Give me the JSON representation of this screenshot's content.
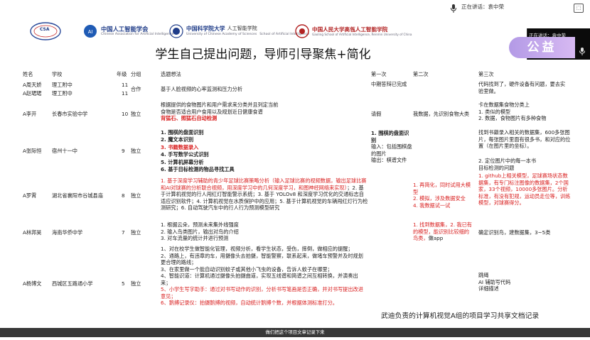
{
  "meeting": {
    "speaking_label": "正在讲话：袁中荣",
    "screen_toggle": "⬚"
  },
  "speaker": {
    "caption": "正在讲话：袁中荣"
  },
  "logos": {
    "csa": "CSA",
    "caai_cn": "中国人工智能学会",
    "caai_en": "Chinese Association for Artificial Intelligence",
    "ucas_cn": "中国科学院大学",
    "ucas_school": "人工智能学院",
    "ucas_en": "University of Chinese Academy of Sciences",
    "ucas_school_en": "School of Artificial Intelligence",
    "ruc_cn": "中国人民大学高瓴人工智能学院",
    "ruc_en": "Gaoling School of Artificial Intelligence, Renmin University of China"
  },
  "badge": "公益",
  "title": "学生自己提出问题，导师引导聚焦+简化",
  "headers": {
    "name": "姓名",
    "school": "学校",
    "grade": "年级",
    "group": "分组",
    "topic": "选题想法",
    "first": "第一次",
    "second": "第二次",
    "third": "第三次"
  },
  "rows": {
    "r1": {
      "name1": "A周天娇",
      "name2": "A赵珺珺",
      "school1": "理工附中",
      "school2": "理工附中",
      "grade1": "11",
      "grade2": "11",
      "group": "合作",
      "topic": "基于人脸视频的心率监测和压力分析",
      "first": "中期答辩已完成",
      "third": "代码找到了，硬件设备有问题，要去实验室做。"
    },
    "r2": {
      "name": "A李开",
      "school": "长春市实验中学",
      "grade": "10",
      "group": "独立",
      "topic1": "根据提供的食物图片和用户需求来分类并且列定当前",
      "topic2": "食物是否适合用户食用以及规划近日健康食谱",
      "topic3": "背猛石、照猛石自动检测",
      "first": "请假",
      "second": "我数据，先识别食物大类",
      "third1": "卡在数据集食物分类上",
      "third2": "1. 类似的模型",
      "third3": "2. 数据，食物图片有多种食物"
    },
    "r3": {
      "name": "A张际恒",
      "school": "宿州十一中",
      "grade": "9",
      "group": "独立",
      "items": [
        "1. 围棋的盘面识别",
        "2. 魔文本识别",
        "3. 书籍数据录入",
        "4. 手写数学公式识别",
        "5. 计算机屏幕分析",
        "6. 基于目标检测的物品寻找工具"
      ],
      "first1": "1. 围棋的盘面识别",
      "first2": "输入：包括围棋盘的图片",
      "first3": "输出：棋谱文件",
      "third": "找到书籍录入相关的数据集，600多张图片，每张图片里面有很多书，和对应的位置（在图片里的坐标）。",
      "third_next1": "2. 定位图片中的每一本书",
      "third_next2": "目标检测的问题"
    },
    "r4": {
      "name": "A罗霄",
      "school": "湖北省襄阳市谷城县庙",
      "grade": "8",
      "group": "独立",
      "topic_red": "1. 基于深度学习辅助的青少年足球比赛策略分析（输入足球比赛的视频数据，输出足球比赛和AI对球赛的分析联合视频，用深度学习中的几何深度学习，和图神经网络来实现）",
      "topic_rest": "；2. 基于计算机视觉的行人闯红灯智能警示系统；3. 基于 YOLOv8 和深度学习优化的交通标志自适应识别软件；4. 计算机视觉在水质保护中的应用；5. 基于计算机视觉的车辆闯红灯行为检测研究；6. 自动驾驶汽车中的行人行为预测模型研究",
      "second": "1. 再简化，同时试用大模型\n2. 模拟，涉及数据安全\n4. 我数据试一试",
      "third": "1. github上相关模型，足球赛场状态数据集，有专门标注图像的数据集，2个国家，33个视频，10000多张图片。分析标准，有没有犯规，运动员走位等，训练模型，对球赛得分。"
    },
    "r5": {
      "name": "A林邦昊",
      "school": "海南华侨中学",
      "grade": "7",
      "group": "独立",
      "items": [
        "1. 根据云朵，预测未来集外线强度",
        "2. 输入鸟类图片，输出对鸟的介绍",
        "3. 对车流量的统计并进行预测"
      ],
      "second_red": "1. 找到数据集，2. 我已有的模型，能识别比较细的鸟类，",
      "second_rest": "做app",
      "third": "确定识别鸟，建数据集，3~5类"
    },
    "r6": {
      "name": "A杨博文",
      "school": "西城区五路通小学",
      "grade": "5",
      "group": "独立",
      "items": [
        "1、对在校学生做智能化管理，视频分析，看学生状态，受伤，摔倒，做相应的提醒；",
        "2、通路上，有违章的车，用摄像头去拍摄，智能警察，联系起来，做堵车预警并及时规划更合理的路线；",
        "3、在家里做一个能自动识别蚊子或其他小飞虫的设备，告诉人蚊子在哪里；",
        "4、智能识道：计算机通过摄像头拍摄曲道，实现五线谱和简谱之间互相转换，并演奏出来；"
      ],
      "red_items": [
        "5、小学生写字助手：通过对书写动作的识别，分析书写笔画是否正确，并对书写提出改进意见；",
        "6、鹅搏记录仪：拍摄鹅搏的视频，自动统计鹅搏个数，并根据体测标准打分。"
      ],
      "third1": "跳绳",
      "third2": "AI 辅助写代码",
      "third3": "详细描述"
    }
  },
  "footnote": "武迪负责的计算机视觉A组的项目学习共享文档记录",
  "caption": "做们把这个项目文章记录下来"
}
